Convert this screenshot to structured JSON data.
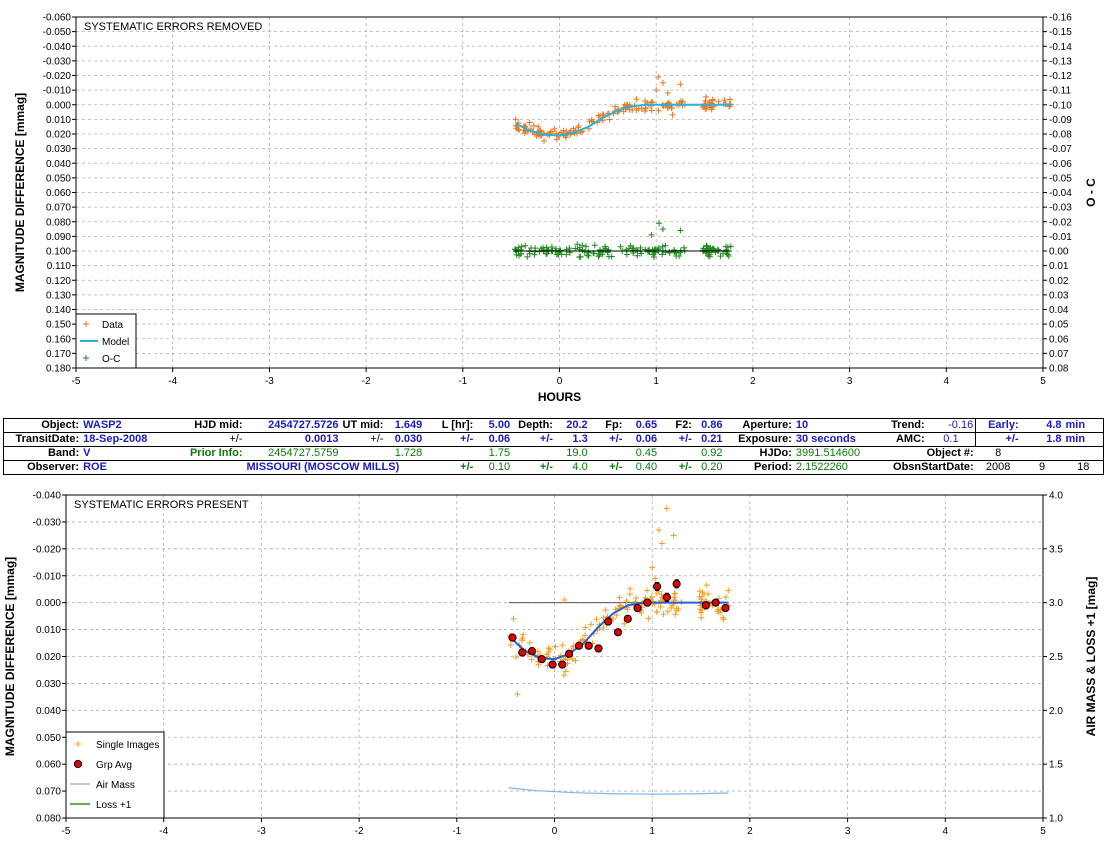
{
  "chart_data": [
    {
      "type": "scatter",
      "title": "SYSTEMATIC ERRORS REMOVED",
      "xlabel": "HOURS",
      "ylabel": "MAGNITUDE DIFFERENCE [mmag]",
      "y2label": "O - C",
      "xlim": [
        -5,
        5
      ],
      "ylim": [
        -0.06,
        0.18
      ],
      "y_inverted": true,
      "y2lim": [
        -0.16,
        0.08
      ],
      "x_ticks": [
        "-5",
        "-4",
        "-3",
        "-2",
        "-1",
        "0",
        "1",
        "2",
        "3",
        "4",
        "5"
      ],
      "y_ticks": [
        "-0.060",
        "-0.050",
        "-0.040",
        "-0.030",
        "-0.020",
        "-0.010",
        "0.000",
        "0.010",
        "0.020",
        "0.030",
        "0.040",
        "0.050",
        "0.060",
        "0.070",
        "0.080",
        "0.090",
        "0.100",
        "0.110",
        "0.120",
        "0.130",
        "0.140",
        "0.150",
        "0.160",
        "0.170",
        "0.180"
      ],
      "y2_ticks": [
        "-0.16",
        "-0.15",
        "-0.14",
        "-0.13",
        "-0.12",
        "-0.11",
        "-0.10",
        "-0.09",
        "-0.08",
        "-0.07",
        "-0.06",
        "-0.05",
        "-0.04",
        "-0.03",
        "-0.02",
        "-0.01",
        "0.00",
        "0.01",
        "0.02",
        "0.03",
        "0.04",
        "0.05",
        "0.06",
        "0.07",
        "0.08"
      ],
      "grid": true,
      "legend": "bottom-left",
      "legend_entries": [
        "Data",
        "Model",
        "O-C"
      ],
      "colors": {
        "data": "#e87722",
        "model": "#27b4d8",
        "oc": "#1f8a1f",
        "oc_line": "#000000"
      },
      "series": [
        {
          "name": "Model",
          "kind": "line",
          "x": [
            -0.45,
            -0.3,
            -0.15,
            0.0,
            0.15,
            0.3,
            0.45,
            0.6,
            0.75,
            0.9,
            1.0,
            1.1,
            1.3,
            1.5,
            1.78
          ],
          "y": [
            0.013,
            0.018,
            0.0205,
            0.021,
            0.019,
            0.015,
            0.009,
            0.004,
            0.001,
            0.0,
            0.0,
            0.0,
            0.0,
            0.0,
            0.0
          ]
        },
        {
          "name": "Data",
          "kind": "points",
          "seed": 7,
          "count": 170,
          "x_range": [
            -0.47,
            1.78
          ],
          "noise": 0.0055,
          "gap": [
            1.3,
            1.48
          ],
          "outliers": [
            [
              1.02,
              -0.019
            ],
            [
              1.07,
              -0.015
            ],
            [
              1.25,
              -0.014
            ],
            [
              1.0,
              -0.01
            ],
            [
              1.12,
              -0.008
            ]
          ]
        },
        {
          "name": "O-C",
          "kind": "points",
          "seed": 13,
          "count": 170,
          "x_range": [
            -0.47,
            1.78
          ],
          "offset": 0.1,
          "noise": 0.005,
          "gap": [
            1.3,
            1.48
          ],
          "outliers": [
            [
              1.03,
              0.081
            ],
            [
              1.07,
              0.085
            ],
            [
              1.25,
              0.086
            ],
            [
              0.95,
              0.089
            ]
          ]
        }
      ],
      "oc_line": {
        "x": [
          -0.47,
          1.78
        ],
        "y": 0.1
      }
    },
    {
      "type": "scatter",
      "title": "SYSTEMATIC ERRORS PRESENT",
      "xlabel": "",
      "ylabel": "MAGNITUDE DIFFERENCE [mmag]",
      "y2label": "AIR MASS & LOSS +1 [mag]",
      "xlim": [
        -5,
        5
      ],
      "ylim": [
        -0.04,
        0.08
      ],
      "y_inverted": true,
      "y2lim": [
        1.0,
        4.0
      ],
      "x_ticks": [
        "-5",
        "-4",
        "-3",
        "-2",
        "-1",
        "0",
        "1",
        "2",
        "3",
        "4",
        "5"
      ],
      "y_ticks": [
        "-0.040",
        "-0.030",
        "-0.020",
        "-0.010",
        "0.000",
        "0.010",
        "0.020",
        "0.030",
        "0.040",
        "0.050",
        "0.060",
        "0.070",
        "0.080"
      ],
      "y2_ticks": [
        "4.0",
        "3.5",
        "3.0",
        "2.5",
        "2.0",
        "1.5",
        "1.0"
      ],
      "grid": true,
      "legend": "bottom-left",
      "legend_entries": [
        "Single Images",
        "Grp Avg",
        "Air Mass",
        "Loss +1"
      ],
      "colors": {
        "single": "#f0a020",
        "grpavg": "#e00000",
        "model": "#2a5fd8",
        "airmass": "#7ab8e8",
        "loss": "#0a7a0a",
        "zero": "#555555"
      },
      "series": [
        {
          "name": "Grp Avg",
          "kind": "errorpoints",
          "x": [
            -0.43,
            -0.33,
            -0.23,
            -0.13,
            -0.02,
            0.08,
            0.15,
            0.25,
            0.35,
            0.45,
            0.55,
            0.65,
            0.75,
            0.85,
            0.95,
            1.05,
            1.15,
            1.25,
            1.55,
            1.65,
            1.75
          ],
          "y": [
            0.013,
            0.0185,
            0.018,
            0.021,
            0.023,
            0.023,
            0.019,
            0.016,
            0.016,
            0.017,
            0.007,
            0.011,
            0.006,
            0.002,
            0.0,
            -0.006,
            -0.002,
            -0.007,
            0.001,
            0.0,
            0.002
          ],
          "err": [
            0.0012,
            0.0012,
            0.0012,
            0.0012,
            0.0012,
            0.0012,
            0.0012,
            0.0012,
            0.0012,
            0.0012,
            0.0012,
            0.0012,
            0.0012,
            0.0012,
            0.0012,
            0.0015,
            0.0015,
            0.0015,
            0.0012,
            0.0012,
            0.0012
          ]
        },
        {
          "name": "Single Images",
          "kind": "points",
          "seed": 21,
          "count": 170,
          "x_range": [
            -0.47,
            1.78
          ],
          "noise": 0.0065,
          "gap": [
            1.3,
            1.48
          ],
          "outliers": [
            [
              1.15,
              -0.035
            ],
            [
              1.07,
              -0.027
            ],
            [
              1.1,
              -0.022
            ],
            [
              1.22,
              -0.025
            ],
            [
              -0.38,
              0.034
            ],
            [
              0.1,
              -0.001
            ],
            [
              1.0,
              -0.013
            ],
            [
              1.03,
              -0.009
            ]
          ]
        },
        {
          "name": "Model",
          "kind": "line",
          "x": [
            -0.45,
            -0.3,
            -0.15,
            0.0,
            0.15,
            0.3,
            0.45,
            0.6,
            0.75,
            0.9,
            1.0,
            1.1,
            1.3,
            1.5,
            1.78
          ],
          "y": [
            0.013,
            0.018,
            0.0205,
            0.021,
            0.019,
            0.015,
            0.009,
            0.004,
            0.001,
            0.0,
            0.0,
            0.0,
            0.0,
            0.0,
            0.0
          ]
        },
        {
          "name": "Air Mass",
          "kind": "line",
          "axis": "y2",
          "x": [
            -0.47,
            -0.2,
            0.2,
            0.6,
            1.0,
            1.4,
            1.78
          ],
          "y": [
            1.28,
            1.255,
            1.235,
            1.225,
            1.222,
            1.224,
            1.232
          ]
        }
      ],
      "zero_line": {
        "x": [
          -0.47,
          1.78
        ],
        "y": 0.0
      }
    }
  ],
  "info": {
    "object_label": "Object:",
    "object": "WASP2",
    "hjdmid_label": "HJD mid:",
    "hjdmid": "2454727.5726",
    "utmid_label": "UT mid:",
    "utmid": "1.649",
    "l_label": "L [hr]:",
    "l": "5.00",
    "depth_label": "Depth:",
    "depth": "20.2",
    "fp_label": "Fp:",
    "fp": "0.65",
    "f2_label": "F2:",
    "f2": "0.86",
    "aperture_label": "Aperture:",
    "aperture": "10",
    "trend_label": "Trend:",
    "trend": "-0.16",
    "early_label": "Early:",
    "early": "4.8",
    "early_unit": "min",
    "transitdate_label": "TransitDate:",
    "transitdate": "18-Sep-2008",
    "pm": "+/-",
    "hjdmid_err": "0.0013",
    "utmid_err": "0.030",
    "l_err": "0.06",
    "depth_err": "1.3",
    "fp_err": "0.06",
    "f2_err": "0.21",
    "exposure_label": "Exposure:",
    "exposure": "30 seconds",
    "amc_label": "AMC:",
    "amc": "0.1",
    "early_err": "1.8",
    "early_err_unit": "min",
    "band_label": "Band:",
    "band": "V",
    "prior_label": "Prior Info:",
    "prior_hjd": "2454727.5759",
    "prior_utmid": "1.728",
    "prior_l": "1.75",
    "prior_depth": "19.0",
    "prior_fp": "0.45",
    "prior_f2": "0.92",
    "hjdo_label": "HJDo:",
    "hjdo": "3991.514600",
    "objectnum_label": "Object #:",
    "objectnum": "8",
    "observer_label": "Observer:",
    "observer": "ROE",
    "location": "MISSOURI (MOSCOW MILLS)",
    "prior_l_err": "0.10",
    "prior_depth_err": "4.0",
    "prior_fp_err": "0.40",
    "prior_f2_err": "0.20",
    "period_label": "Period:",
    "period": "2.1522260",
    "obsstart_label": "ObsnStartDate:",
    "obs_year": "2008",
    "obs_month": "9",
    "obs_day": "18"
  }
}
